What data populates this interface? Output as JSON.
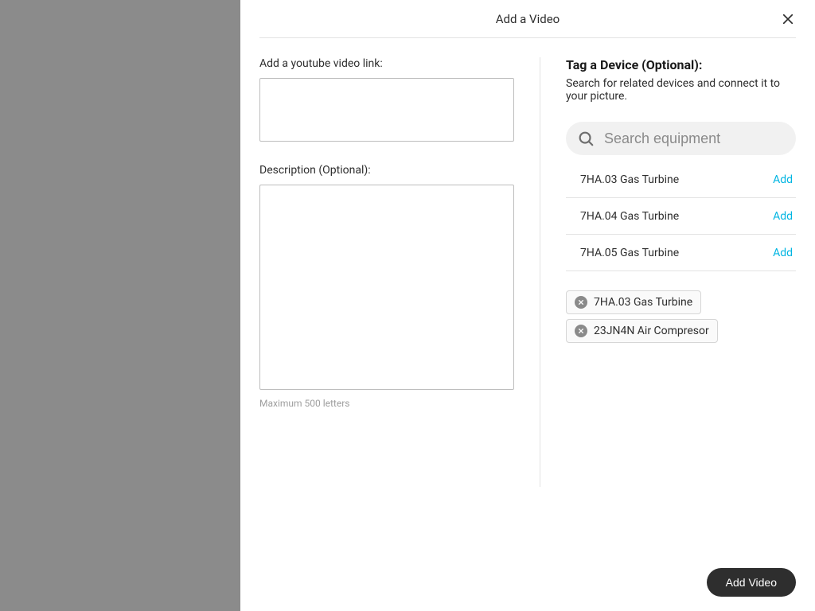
{
  "header": {
    "title": "Add a Video"
  },
  "left": {
    "link_label": "Add a youtube video link:",
    "link_value": "",
    "desc_label": "Description (Optional):",
    "desc_value": "",
    "helper": "Maximum 500 letters"
  },
  "right": {
    "tag_title": "Tag a Device (Optional):",
    "tag_sub": "Search for related devices and connect it to your picture.",
    "search_placeholder": "Search equipment",
    "add_label": "Add",
    "results": [
      {
        "name": "7HA.03 Gas Turbine"
      },
      {
        "name": "7HA.04 Gas Turbine"
      },
      {
        "name": "7HA.05 Gas Turbine"
      }
    ],
    "chips": [
      {
        "label": "7HA.03 Gas Turbine"
      },
      {
        "label": "23JN4N Air Compresor"
      }
    ]
  },
  "footer": {
    "primary": "Add Video"
  }
}
